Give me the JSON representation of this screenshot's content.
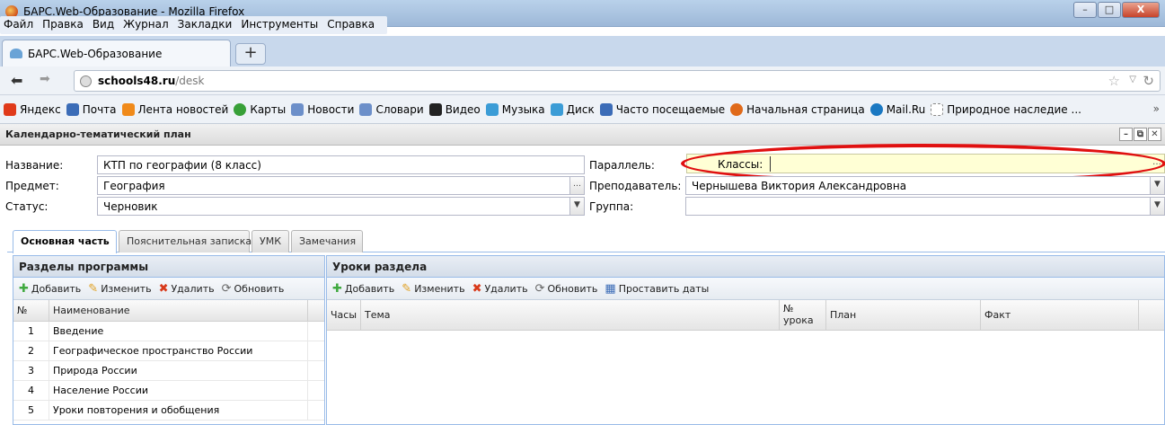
{
  "window": {
    "title": "БАРС.Web-Образование - Mozilla Firefox",
    "minimize": "–",
    "maximize": "□",
    "close": "X"
  },
  "menu": [
    "Файл",
    "Правка",
    "Вид",
    "Журнал",
    "Закладки",
    "Инструменты",
    "Справка"
  ],
  "browser_tab": {
    "title": "БАРС.Web-Образование",
    "new_tab": "+"
  },
  "nav": {
    "url_host": "schools48.ru",
    "url_path": "/desk"
  },
  "bookmarks": [
    {
      "label": "Яндекс",
      "color": "#e03a1a"
    },
    {
      "label": "Почта",
      "color": "#3b6cb7"
    },
    {
      "label": "Лента новостей",
      "color": "#f08a1a"
    },
    {
      "label": "Карты",
      "color": "#38a038"
    },
    {
      "label": "Новости",
      "color": "#3b6cb7"
    },
    {
      "label": "Словари",
      "color": "#3b6cb7"
    },
    {
      "label": "Видео",
      "color": "#222222"
    },
    {
      "label": "Музыка",
      "color": "#3b9cd6"
    },
    {
      "label": "Диск",
      "color": "#3b9cd6"
    },
    {
      "label": "Часто посещаемые",
      "color": "#3b6cb7"
    },
    {
      "label": "Начальная страница",
      "color": "#e06a1a"
    },
    {
      "label": "Mail.Ru",
      "color": "#1a78c2"
    },
    {
      "label": "Природное наследие ...",
      "color": "#ffffff"
    }
  ],
  "bookmarks_more": "»",
  "panel": {
    "title": "Календарно-тематический план"
  },
  "form": {
    "name_label": "Название:",
    "name_value": "КТП по географии (8 класс)",
    "subject_label": "Предмет:",
    "subject_value": "География",
    "status_label": "Статус:",
    "status_value": "Черновик",
    "parallel_label": "Параллель:",
    "classes_label": "Классы:",
    "classes_value": "",
    "teacher_label": "Преподаватель:",
    "teacher_value": "Чернышева Виктория Александровна",
    "group_label": "Группа:",
    "group_value": ""
  },
  "tabs": [
    "Основная часть",
    "Пояснительная записка",
    "УМК",
    "Замечания"
  ],
  "sections": {
    "title": "Разделы программы",
    "toolbar": {
      "add": "Добавить",
      "edit": "Изменить",
      "delete": "Удалить",
      "refresh": "Обновить"
    },
    "columns": [
      "№",
      "Наименование"
    ],
    "rows": [
      [
        "1",
        "Введение"
      ],
      [
        "2",
        "Географическое пространство России"
      ],
      [
        "3",
        "Природа России"
      ],
      [
        "4",
        "Население России"
      ],
      [
        "5",
        "Уроки повторения и обобщения"
      ]
    ]
  },
  "lessons": {
    "title": "Уроки раздела",
    "toolbar": {
      "add": "Добавить",
      "edit": "Изменить",
      "delete": "Удалить",
      "refresh": "Обновить",
      "set_dates": "Проставить даты"
    },
    "columns": {
      "hours": "Часы",
      "topic": "Тема",
      "num_line1": "№",
      "num_line2": "урока",
      "plan": "План",
      "fact": "Факт"
    }
  }
}
